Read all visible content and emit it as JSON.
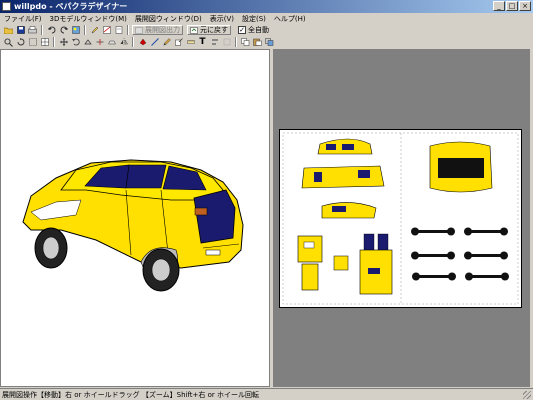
{
  "window": {
    "title": "willpdo - ペパクラデザイナー",
    "minimize": "_",
    "maximize": "□",
    "close": "×"
  },
  "menu": [
    "ファイル(F)",
    "3Dモデルウィンドウ(M)",
    "展開図ウィンドウ(D)",
    "表示(V)",
    "設定(S)",
    "ヘルプ(H)"
  ],
  "toolbar1": {
    "unfold_label": "展開図出力",
    "restore_label": "元に戻す",
    "auto_move_label": "全自動",
    "auto_move_checked": "✓"
  },
  "status": {
    "text": "展開図操作【移動】右 or ホイールドラッグ 【ズーム】Shift+右 or ホイール回転"
  },
  "colors": {
    "car_body": "#ffe000",
    "window_blue": "#1a1a6e",
    "pane_gray": "#808080"
  }
}
